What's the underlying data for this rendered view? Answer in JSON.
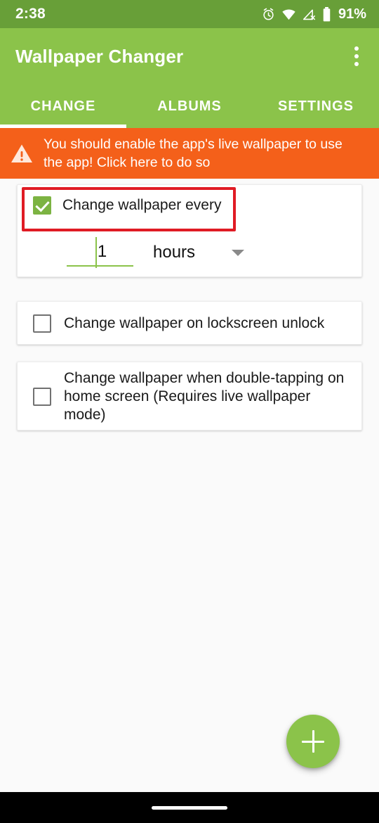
{
  "status_bar": {
    "clock": "2:38",
    "battery_percent": "91%",
    "icons": [
      "alarm-icon",
      "wifi-icon",
      "no-signal-icon",
      "battery-icon"
    ],
    "background_color": "#689F38"
  },
  "app_bar": {
    "title": "Wallpaper Changer",
    "overflow_menu": "overflow-menu",
    "background_color": "#8BC34A"
  },
  "tabs": {
    "active_index": 0,
    "items": [
      {
        "label": "CHANGE"
      },
      {
        "label": "ALBUMS"
      },
      {
        "label": "SETTINGS"
      }
    ]
  },
  "warning_banner": {
    "text": "You should enable the app's live wallpaper to use the app! Click here to do so",
    "icon": "warning-triangle-icon",
    "background_color": "#F4601A"
  },
  "cards": {
    "interval": {
      "checkbox_label": "Change wallpaper every",
      "checked": true,
      "interval_value": "1",
      "unit_value": "hours",
      "highlighted": true,
      "highlight_color": "#E01B24"
    },
    "lockscreen": {
      "checkbox_label": "Change wallpaper on lockscreen unlock",
      "checked": false
    },
    "doubletap": {
      "checkbox_label": "Change wallpaper when double-tapping on home screen (Requires live wallpaper mode)",
      "checked": false
    }
  },
  "fab": {
    "icon": "plus-icon",
    "color": "#8BC34A"
  },
  "nav_bar": {
    "gesture_pill": "home-gesture-pill"
  }
}
